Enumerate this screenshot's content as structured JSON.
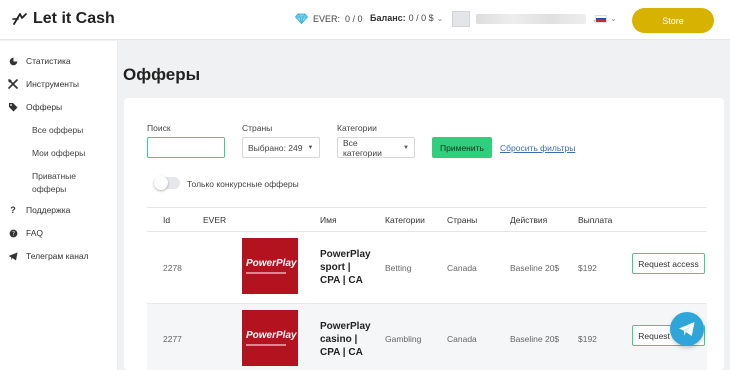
{
  "header": {
    "logo_text": "Let it Cash",
    "ever_label": "EVER:",
    "ever_value": "0 / 0",
    "balance_label": "Баланс:",
    "balance_value": "0 / 0 $",
    "store_label": "Store"
  },
  "sidebar": {
    "items": [
      {
        "label": "Статистика",
        "icon": "pie-chart-icon"
      },
      {
        "label": "Инструменты",
        "icon": "tools-icon"
      },
      {
        "label": "Офферы",
        "icon": "tag-icon"
      },
      {
        "label": "Поддержка",
        "icon": "question-icon"
      },
      {
        "label": "FAQ",
        "icon": "help-circle-icon"
      },
      {
        "label": "Телеграм канал",
        "icon": "telegram-icon"
      }
    ],
    "sub_items": [
      "Все офферы",
      "Мои офферы",
      "Приватные",
      "офферы"
    ]
  },
  "page_title": "Офферы",
  "filters": {
    "search_label": "Поиск",
    "search_value": "",
    "countries_label": "Страны",
    "countries_value": "Выбрано: 249",
    "categories_label": "Категории",
    "categories_value": "Все категории",
    "apply_label": "Применить",
    "reset_label": "Сбросить фильтры",
    "toggle_label": "Только конкурсные офферы"
  },
  "table": {
    "headers": [
      "Id",
      "EVER",
      "Имя",
      "Категории",
      "Страны",
      "Действия",
      "Выплата"
    ],
    "rows": [
      {
        "id": "2278",
        "ever": "",
        "logo_text": "PowerPlay",
        "name_lines": [
          "PowerPlay",
          "sport |",
          "CPA | CA"
        ],
        "category": "Betting",
        "country": "Canada",
        "action": "Baseline 20$",
        "payout": "$192",
        "button": "Request access"
      },
      {
        "id": "2277",
        "ever": "",
        "logo_text": "PowerPlay",
        "name_lines": [
          "PowerPlay",
          "casino |",
          "CPA | CA"
        ],
        "category": "Gambling",
        "country": "Canada",
        "action": "Baseline 20$",
        "payout": "$192",
        "button": "Request access"
      }
    ]
  },
  "colors": {
    "accent_green": "#2fd07d",
    "store_gold": "#d7b300",
    "brand_red": "#b3121f",
    "telegram_blue": "#2ea6da"
  }
}
